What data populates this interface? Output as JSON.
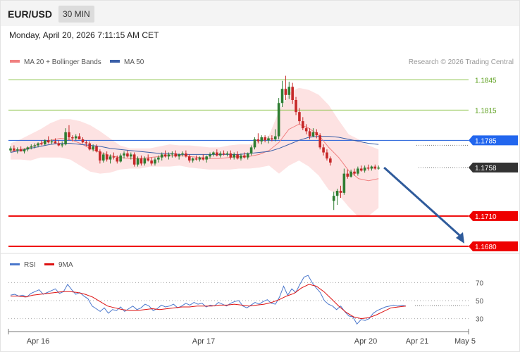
{
  "header": {
    "symbol": "EUR/USD",
    "timeframe": "30 MIN"
  },
  "datetime": "Monday, April 20, 2026 7:11:15 AM CET",
  "legend": [
    {
      "label": "MA 20 + Bollinger Bands",
      "color": "#f08080"
    },
    {
      "label": "MA 50",
      "color": "#3a5fa8"
    }
  ],
  "copyright": "Research © 2026 Trading Central",
  "colors": {
    "bull": "#2e7d32",
    "bear": "#c62828",
    "resistance": "#8bc34a",
    "pivot": "#1e5bd8",
    "support": "#ee0000",
    "last": "#333333",
    "arrow": "#2f5b9b"
  },
  "chart_data": [
    {
      "type": "candlestick",
      "title": "EUR/USD",
      "x_ticks": [
        "Apr 16",
        "Apr 17",
        "Apr 20",
        "Apr 21",
        "May 5"
      ],
      "ylim": [
        1.1675,
        1.1855
      ],
      "levels": [
        {
          "label": "1.1845",
          "value": 1.1845,
          "kind": "resistance"
        },
        {
          "label": "1.1815",
          "value": 1.1815,
          "kind": "resistance"
        },
        {
          "label": "1.1785",
          "value": 1.1785,
          "kind": "pivot"
        },
        {
          "label": "1.1758",
          "value": 1.1758,
          "kind": "last"
        },
        {
          "label": "1.1710",
          "value": 1.171,
          "kind": "support"
        },
        {
          "label": "1.1680",
          "value": 1.168,
          "kind": "support"
        }
      ],
      "forecast": {
        "from": 1.1758,
        "to": 1.168,
        "direction": "down"
      },
      "candles": [
        [
          1.1775,
          1.1779,
          1.1773,
          1.1777
        ],
        [
          1.1777,
          1.178,
          1.1774,
          1.1775
        ],
        [
          1.1775,
          1.1778,
          1.1772,
          1.1776
        ],
        [
          1.1776,
          1.1779,
          1.1774,
          1.1774
        ],
        [
          1.1774,
          1.1777,
          1.1772,
          1.1776
        ],
        [
          1.1776,
          1.1779,
          1.1774,
          1.1778
        ],
        [
          1.1778,
          1.1781,
          1.1776,
          1.1779
        ],
        [
          1.1779,
          1.1782,
          1.1777,
          1.178
        ],
        [
          1.178,
          1.1783,
          1.1778,
          1.1782
        ],
        [
          1.1782,
          1.1785,
          1.178,
          1.1781
        ],
        [
          1.1781,
          1.1786,
          1.178,
          1.1785
        ],
        [
          1.1785,
          1.1789,
          1.1782,
          1.1783
        ],
        [
          1.1783,
          1.1786,
          1.1781,
          1.1784
        ],
        [
          1.1784,
          1.1787,
          1.1782,
          1.1782
        ],
        [
          1.1782,
          1.1785,
          1.1779,
          1.178
        ],
        [
          1.178,
          1.1784,
          1.1778,
          1.1781
        ],
        [
          1.1781,
          1.1797,
          1.178,
          1.1793
        ],
        [
          1.1793,
          1.18,
          1.1785,
          1.1788
        ],
        [
          1.1788,
          1.179,
          1.1784,
          1.1787
        ],
        [
          1.1787,
          1.1791,
          1.1785,
          1.1789
        ],
        [
          1.1789,
          1.1792,
          1.1786,
          1.1786
        ],
        [
          1.1786,
          1.1788,
          1.1782,
          1.1783
        ],
        [
          1.1783,
          1.1785,
          1.1779,
          1.1782
        ],
        [
          1.1782,
          1.1784,
          1.1775,
          1.1776
        ],
        [
          1.1776,
          1.1781,
          1.1774,
          1.1779
        ],
        [
          1.1779,
          1.1781,
          1.1773,
          1.1774
        ],
        [
          1.1774,
          1.1776,
          1.1762,
          1.1765
        ],
        [
          1.1765,
          1.1773,
          1.1763,
          1.1771
        ],
        [
          1.1771,
          1.1774,
          1.1764,
          1.1766
        ],
        [
          1.1766,
          1.1771,
          1.1762,
          1.1769
        ],
        [
          1.1769,
          1.1773,
          1.1766,
          1.1768
        ],
        [
          1.1768,
          1.177,
          1.1762,
          1.1764
        ],
        [
          1.1764,
          1.1772,
          1.1763,
          1.177
        ],
        [
          1.177,
          1.1774,
          1.1767,
          1.1772
        ],
        [
          1.1772,
          1.1775,
          1.1768,
          1.1769
        ],
        [
          1.1769,
          1.1773,
          1.1766,
          1.1771
        ],
        [
          1.1771,
          1.1773,
          1.1759,
          1.1761
        ],
        [
          1.1761,
          1.1769,
          1.1759,
          1.1767
        ],
        [
          1.1767,
          1.177,
          1.176,
          1.1762
        ],
        [
          1.1762,
          1.1769,
          1.176,
          1.1767
        ],
        [
          1.1767,
          1.1771,
          1.1764,
          1.1765
        ],
        [
          1.1765,
          1.1768,
          1.176,
          1.1762
        ],
        [
          1.1762,
          1.1768,
          1.176,
          1.1766
        ],
        [
          1.1766,
          1.177,
          1.1763,
          1.1768
        ],
        [
          1.1768,
          1.1773,
          1.1765,
          1.1771
        ],
        [
          1.1771,
          1.1775,
          1.1768,
          1.1769
        ],
        [
          1.1769,
          1.1773,
          1.1766,
          1.1771
        ],
        [
          1.1771,
          1.1774,
          1.1768,
          1.1772
        ],
        [
          1.1772,
          1.1775,
          1.1768,
          1.1769
        ],
        [
          1.1769,
          1.1772,
          1.1766,
          1.1771
        ],
        [
          1.1771,
          1.1774,
          1.1769,
          1.1772
        ],
        [
          1.1772,
          1.1775,
          1.1768,
          1.1769
        ],
        [
          1.1769,
          1.1771,
          1.1763,
          1.1765
        ],
        [
          1.1765,
          1.1768,
          1.1763,
          1.1767
        ],
        [
          1.1767,
          1.177,
          1.1765,
          1.1766
        ],
        [
          1.1766,
          1.1769,
          1.1764,
          1.1768
        ],
        [
          1.1768,
          1.1771,
          1.1765,
          1.1766
        ],
        [
          1.1766,
          1.177,
          1.1763,
          1.1769
        ],
        [
          1.1769,
          1.1773,
          1.1767,
          1.1771
        ],
        [
          1.1771,
          1.1774,
          1.1769,
          1.1773
        ],
        [
          1.1773,
          1.1776,
          1.1769,
          1.177
        ],
        [
          1.177,
          1.1774,
          1.1768,
          1.1772
        ],
        [
          1.1772,
          1.1775,
          1.177,
          1.1771
        ],
        [
          1.1771,
          1.1774,
          1.1769,
          1.1772
        ],
        [
          1.1772,
          1.1775,
          1.1766,
          1.1768
        ],
        [
          1.1768,
          1.1773,
          1.1766,
          1.1771
        ],
        [
          1.1771,
          1.1774,
          1.1766,
          1.1767
        ],
        [
          1.1767,
          1.1772,
          1.1765,
          1.177
        ],
        [
          1.177,
          1.1773,
          1.1767,
          1.1768
        ],
        [
          1.1768,
          1.1773,
          1.1766,
          1.1772
        ],
        [
          1.1772,
          1.178,
          1.177,
          1.1778
        ],
        [
          1.1778,
          1.1788,
          1.1776,
          1.1786
        ],
        [
          1.1786,
          1.1792,
          1.1782,
          1.1784
        ],
        [
          1.1784,
          1.179,
          1.1781,
          1.1788
        ],
        [
          1.1788,
          1.179,
          1.1783,
          1.1785
        ],
        [
          1.1785,
          1.1789,
          1.1782,
          1.1787
        ],
        [
          1.1787,
          1.179,
          1.1784,
          1.1786
        ],
        [
          1.1786,
          1.1796,
          1.1784,
          1.1789
        ],
        [
          1.1789,
          1.1827,
          1.1786,
          1.1822
        ],
        [
          1.1822,
          1.1844,
          1.1818,
          1.1836
        ],
        [
          1.1836,
          1.1849,
          1.1825,
          1.183
        ],
        [
          1.183,
          1.1843,
          1.1826,
          1.1838
        ],
        [
          1.1838,
          1.1842,
          1.1821,
          1.1825
        ],
        [
          1.1825,
          1.1828,
          1.181,
          1.1813
        ],
        [
          1.1813,
          1.1817,
          1.1801,
          1.1804
        ],
        [
          1.1804,
          1.1808,
          1.1795,
          1.1797
        ],
        [
          1.1797,
          1.1801,
          1.1791,
          1.1794
        ],
        [
          1.1794,
          1.1797,
          1.1786,
          1.1789
        ],
        [
          1.1789,
          1.1797,
          1.1788,
          1.1793
        ],
        [
          1.1793,
          1.1796,
          1.1787,
          1.179
        ],
        [
          1.179,
          1.1792,
          1.1776,
          1.1778
        ],
        [
          1.1778,
          1.1781,
          1.177,
          1.1773
        ],
        [
          1.1773,
          1.1776,
          1.1765,
          1.1767
        ],
        [
          1.1767,
          1.1769,
          1.176,
          1.1763
        ],
        [
          1.1725,
          1.1734,
          1.1716,
          1.173
        ],
        [
          1.173,
          1.1737,
          1.1721,
          1.1735
        ],
        [
          1.1735,
          1.174,
          1.1728,
          1.1733
        ],
        [
          1.1733,
          1.1757,
          1.1731,
          1.1752
        ],
        [
          1.1752,
          1.1756,
          1.1747,
          1.1749
        ],
        [
          1.1749,
          1.1756,
          1.1748,
          1.1754
        ],
        [
          1.1754,
          1.1757,
          1.175,
          1.1752
        ],
        [
          1.1752,
          1.1759,
          1.175,
          1.1757
        ],
        [
          1.1757,
          1.176,
          1.1754,
          1.1755
        ],
        [
          1.1755,
          1.176,
          1.1753,
          1.1758
        ],
        [
          1.1758,
          1.1761,
          1.1755,
          1.1757
        ],
        [
          1.1757,
          1.176,
          1.1755,
          1.1759
        ],
        [
          1.1759,
          1.1761,
          1.1756,
          1.1757
        ],
        [
          1.1757,
          1.176,
          1.1756,
          1.1758
        ]
      ],
      "ma20": [
        1.1774,
        1.1776,
        1.1778,
        1.1782,
        1.1785,
        1.1787,
        1.1786,
        1.1782,
        1.1777,
        1.1773,
        1.177,
        1.1768,
        1.1767,
        1.1767,
        1.1768,
        1.1769,
        1.177,
        1.177,
        1.1769,
        1.1768,
        1.1767,
        1.1767,
        1.1768,
        1.1769,
        1.1769,
        1.1771,
        1.1775,
        1.1783,
        1.1796,
        1.1801,
        1.1797,
        1.179,
        1.1778,
        1.1768,
        1.1755,
        1.1747,
        1.1745,
        1.1747
      ],
      "ma50": [
        1.1773,
        1.1775,
        1.1777,
        1.1779,
        1.1781,
        1.1782,
        1.1782,
        1.1781,
        1.178,
        1.1779,
        1.1777,
        1.1776,
        1.1775,
        1.1774,
        1.1773,
        1.1772,
        1.1772,
        1.1771,
        1.1771,
        1.1771,
        1.1771,
        1.1771,
        1.1771,
        1.1771,
        1.1772,
        1.1773,
        1.1774,
        1.1777,
        1.1781,
        1.1785,
        1.1788,
        1.1789,
        1.1789,
        1.1788,
        1.1786,
        1.1784,
        1.1782,
        1.1781
      ],
      "bb_upper": [
        1.1782,
        1.1786,
        1.1791,
        1.1796,
        1.1802,
        1.1806,
        1.1806,
        1.1804,
        1.18,
        1.1794,
        1.1787,
        1.178,
        1.1777,
        1.1777,
        1.1777,
        1.1779,
        1.1781,
        1.178,
        1.178,
        1.1779,
        1.1778,
        1.1778,
        1.178,
        1.1781,
        1.1781,
        1.1784,
        1.179,
        1.1814,
        1.1832,
        1.1837,
        1.1835,
        1.183,
        1.182,
        1.1805,
        1.1791,
        1.1786,
        1.178,
        1.1776
      ],
      "bb_lower": [
        1.1766,
        1.1766,
        1.1765,
        1.1768,
        1.1768,
        1.1768,
        1.1766,
        1.176,
        1.1754,
        1.1752,
        1.1753,
        1.1756,
        1.1757,
        1.1757,
        1.1759,
        1.1759,
        1.1759,
        1.176,
        1.1758,
        1.1757,
        1.1756,
        1.1756,
        1.1756,
        1.1757,
        1.1757,
        1.1758,
        1.176,
        1.1752,
        1.176,
        1.1765,
        1.1759,
        1.175,
        1.1736,
        1.1731,
        1.1719,
        1.1709,
        1.171,
        1.1718
      ]
    },
    {
      "type": "line",
      "title": "RSI",
      "x_ticks": [
        "Apr 16",
        "Apr 17",
        "Apr 20",
        "Apr 21",
        "May 5"
      ],
      "y_ticks": [
        70,
        50,
        30
      ],
      "ylim": [
        18,
        82
      ],
      "series": [
        {
          "name": "RSI",
          "color": "#4a77cc",
          "values": [
            56,
            57,
            55,
            56,
            54,
            58,
            60,
            62,
            57,
            59,
            61,
            63,
            58,
            60,
            68,
            62,
            57,
            59,
            55,
            52,
            44,
            41,
            38,
            42,
            36,
            40,
            39,
            43,
            38,
            41,
            44,
            40,
            42,
            46,
            44,
            39,
            41,
            45,
            43,
            44,
            46,
            42,
            44,
            47,
            45,
            48,
            46,
            47,
            43,
            45,
            44,
            48,
            46,
            44,
            47,
            49,
            50,
            44,
            42,
            45,
            48,
            46,
            49,
            51,
            47,
            46,
            54,
            66,
            56,
            63,
            59,
            68,
            76,
            78,
            70,
            64,
            59,
            50,
            46,
            44,
            40,
            44,
            38,
            33,
            32,
            24,
            29,
            28,
            30,
            36,
            39,
            41,
            43,
            44,
            45,
            44,
            45,
            44
          ]
        },
        {
          "name": "9MA",
          "color": "#dd1111",
          "values": [
            55,
            55,
            54,
            56,
            57,
            58,
            59,
            60,
            60,
            59,
            57,
            54,
            49,
            44,
            42,
            40,
            39,
            39,
            40,
            41,
            40,
            41,
            42,
            43,
            43,
            44,
            44,
            44,
            45,
            45,
            46,
            45,
            44,
            45,
            46,
            48,
            51,
            55,
            58,
            64,
            68,
            66,
            60,
            52,
            44,
            37,
            32,
            30,
            31,
            34,
            38,
            42,
            43,
            44
          ]
        }
      ]
    }
  ]
}
